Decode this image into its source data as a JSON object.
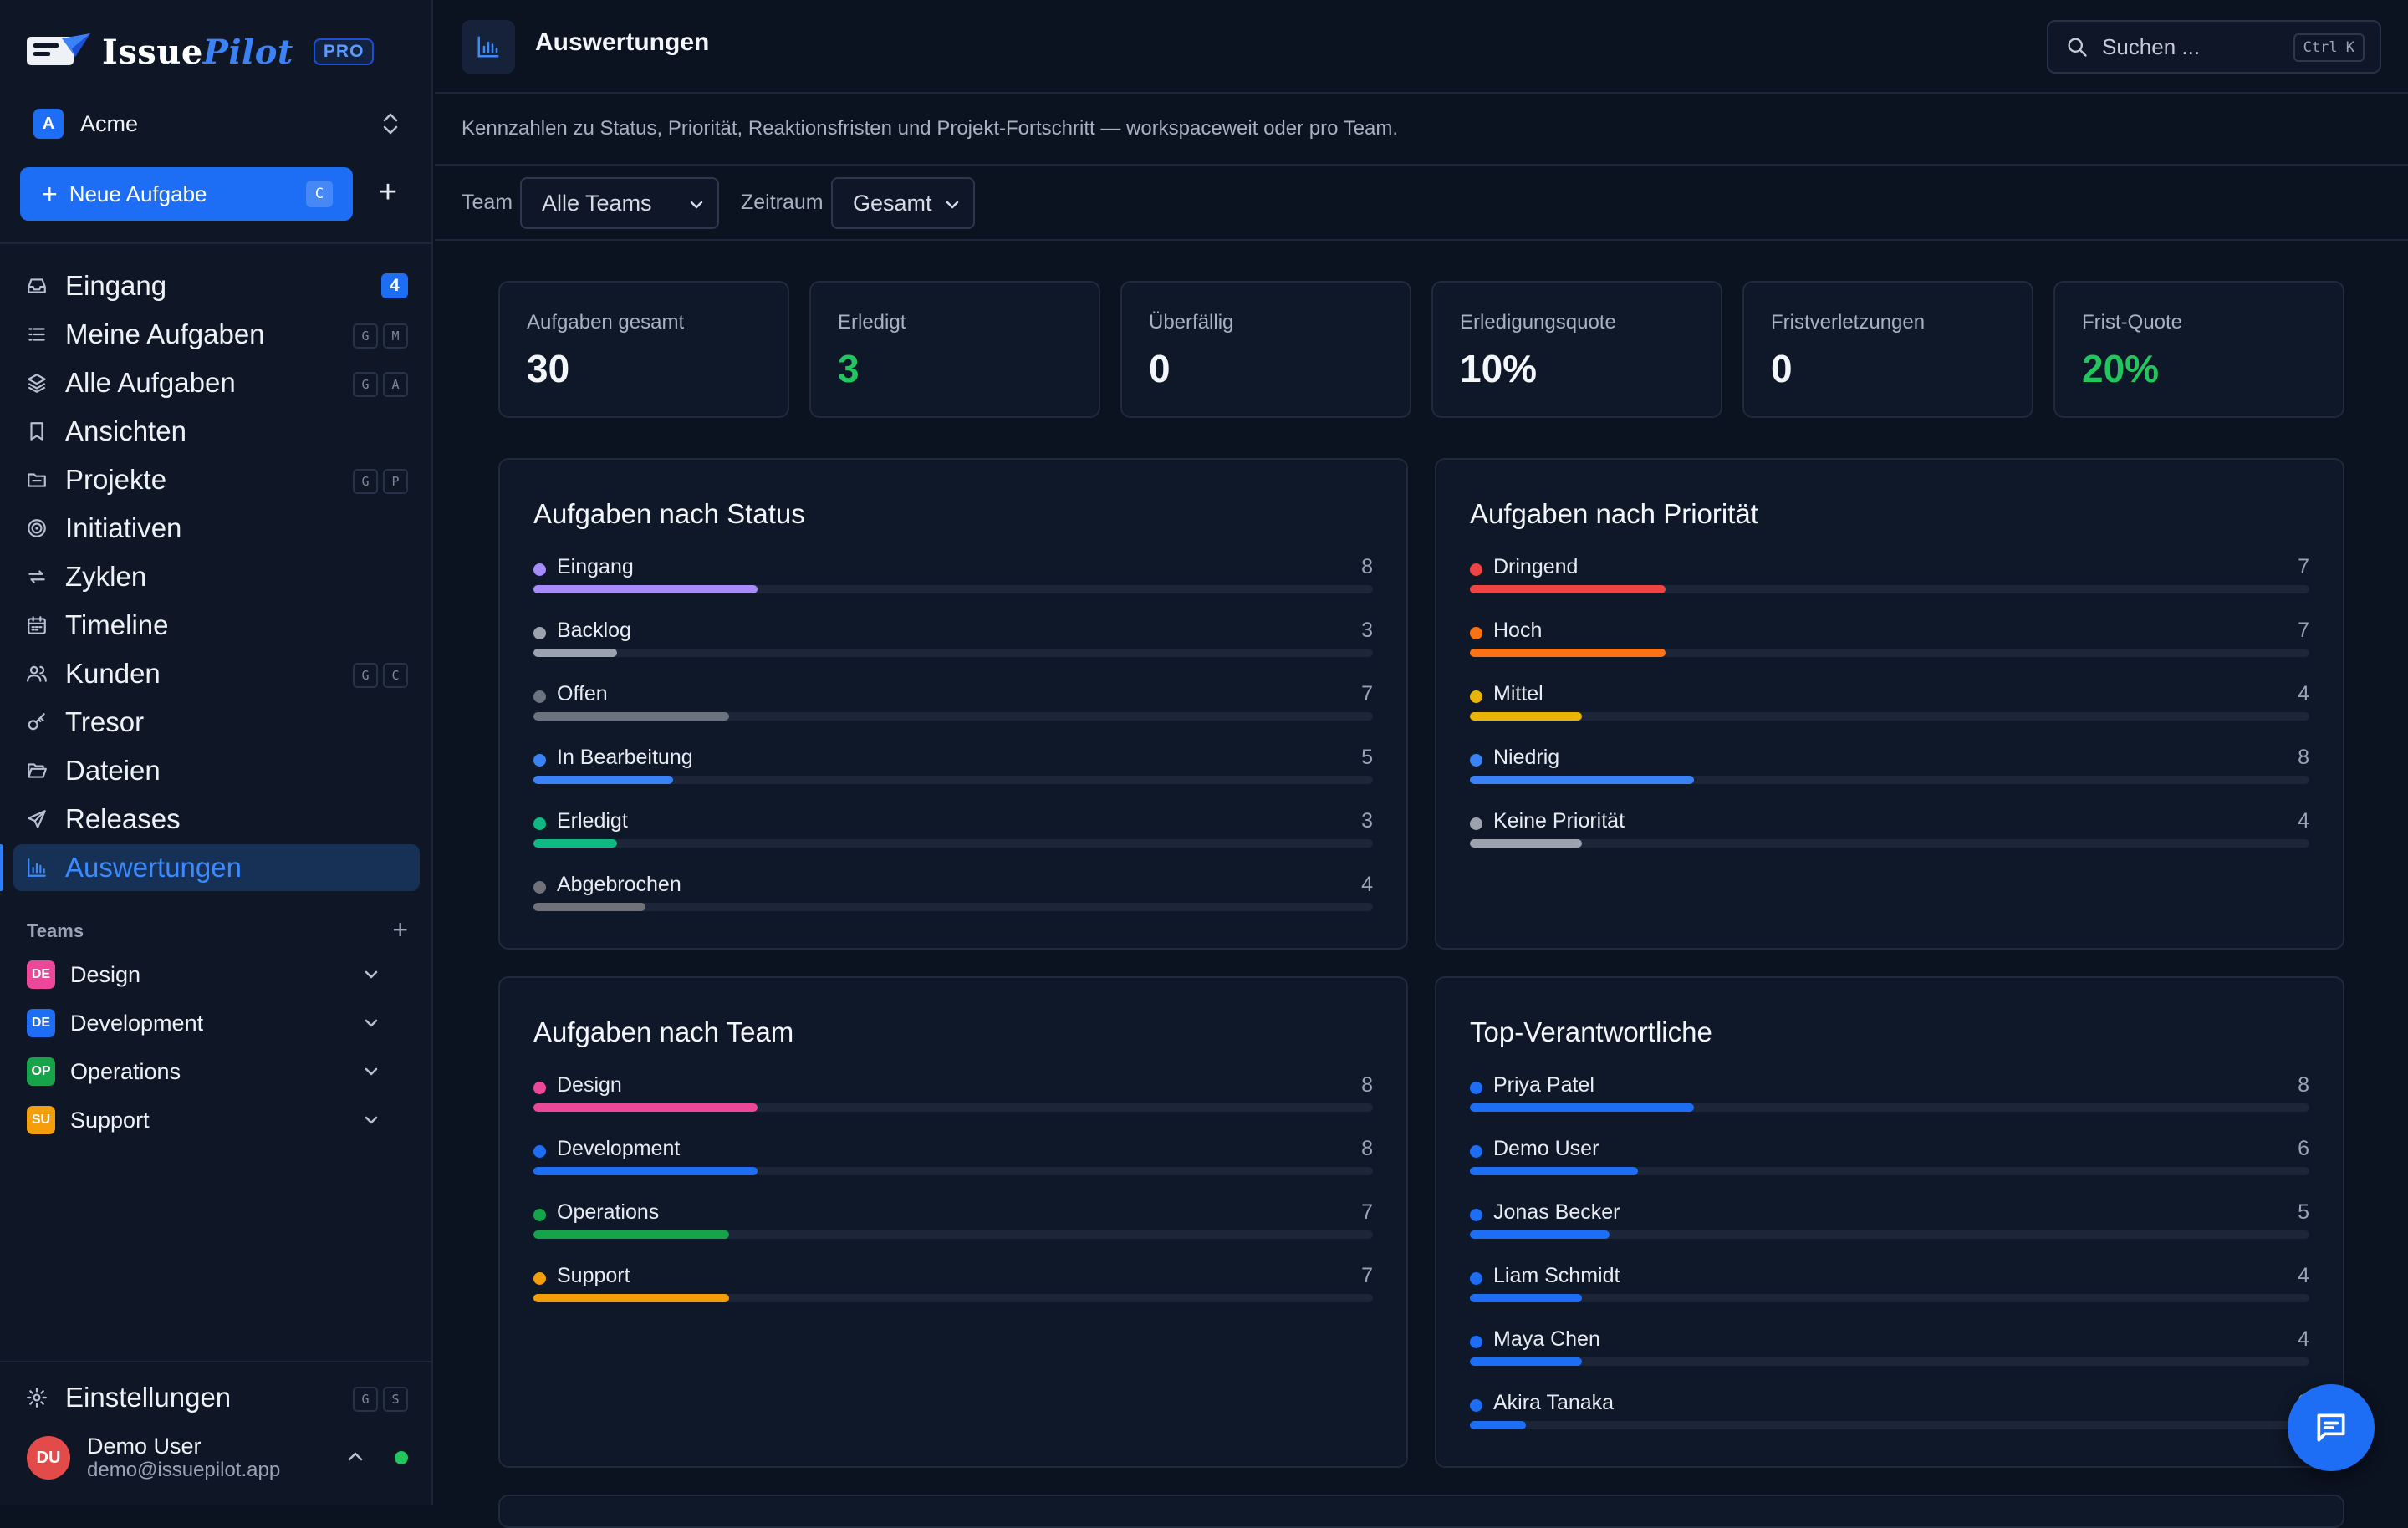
{
  "brand": {
    "name_a": "Issue",
    "name_b": "Pilot",
    "badge": "PRO"
  },
  "workspace": {
    "initial": "A",
    "name": "Acme"
  },
  "new_task": {
    "label": "Neue Aufgabe",
    "shortcut": "C"
  },
  "nav": [
    {
      "label": "Eingang",
      "icon": "inbox-icon",
      "badge": "4"
    },
    {
      "label": "Meine Aufgaben",
      "icon": "list-icon",
      "shortcut": [
        "G",
        "M"
      ]
    },
    {
      "label": "Alle Aufgaben",
      "icon": "layers-icon",
      "shortcut": [
        "G",
        "A"
      ]
    },
    {
      "label": "Ansichten",
      "icon": "bookmark-icon"
    },
    {
      "label": "Projekte",
      "icon": "folder-icon",
      "shortcut": [
        "G",
        "P"
      ]
    },
    {
      "label": "Initiativen",
      "icon": "target-icon"
    },
    {
      "label": "Zyklen",
      "icon": "cycle-icon"
    },
    {
      "label": "Timeline",
      "icon": "calendar-icon"
    },
    {
      "label": "Kunden",
      "icon": "users-icon",
      "shortcut": [
        "G",
        "C"
      ]
    },
    {
      "label": "Tresor",
      "icon": "key-icon"
    },
    {
      "label": "Dateien",
      "icon": "folder-open-icon"
    },
    {
      "label": "Releases",
      "icon": "send-icon"
    },
    {
      "label": "Auswertungen",
      "icon": "bar-chart-icon",
      "active": true
    }
  ],
  "teams": {
    "title": "Teams",
    "items": [
      {
        "initials": "DE",
        "name": "Design",
        "color": "#ec4899"
      },
      {
        "initials": "DE",
        "name": "Development",
        "color": "#1d6ef5"
      },
      {
        "initials": "OP",
        "name": "Operations",
        "color": "#16a34a"
      },
      {
        "initials": "SU",
        "name": "Support",
        "color": "#f59e0b"
      }
    ]
  },
  "settings": {
    "label": "Einstellungen",
    "shortcut": [
      "G",
      "S"
    ]
  },
  "user": {
    "initials": "DU",
    "name": "Demo User",
    "email": "demo@issuepilot.app"
  },
  "header": {
    "title": "Auswertungen",
    "search_placeholder": "Suchen ...",
    "search_shortcut": "Ctrl K",
    "subtitle": "Kennzahlen zu Status, Priorität, Reaktionsfristen und Projekt-Fortschritt — workspaceweit oder pro Team."
  },
  "filters": {
    "team_label": "Team",
    "team_value": "Alle Teams",
    "period_label": "Zeitraum",
    "period_value": "Gesamt"
  },
  "kpis": [
    {
      "label": "Aufgaben gesamt",
      "value": "30"
    },
    {
      "label": "Erledigt",
      "value": "3",
      "accent": "#22c55e"
    },
    {
      "label": "Überfällig",
      "value": "0"
    },
    {
      "label": "Erledigungsquote",
      "value": "10%"
    },
    {
      "label": "Fristverletzungen",
      "value": "0"
    },
    {
      "label": "Frist-Quote",
      "value": "20%",
      "accent": "#22c55e"
    }
  ],
  "panels": {
    "status": {
      "title": "Aufgaben nach Status",
      "max": 30,
      "rows": [
        {
          "label": "Eingang",
          "value": 8,
          "color": "#a78bfa"
        },
        {
          "label": "Backlog",
          "value": 3,
          "color": "#9ca3af"
        },
        {
          "label": "Offen",
          "value": 7,
          "color": "#6b7280"
        },
        {
          "label": "In Bearbeitung",
          "value": 5,
          "color": "#3b82f6"
        },
        {
          "label": "Erledigt",
          "value": 3,
          "color": "#10b981"
        },
        {
          "label": "Abgebrochen",
          "value": 4,
          "color": "#71717a"
        }
      ]
    },
    "priority": {
      "title": "Aufgaben nach Priorität",
      "max": 30,
      "rows": [
        {
          "label": "Dringend",
          "value": 7,
          "color": "#ef4444"
        },
        {
          "label": "Hoch",
          "value": 7,
          "color": "#f97316"
        },
        {
          "label": "Mittel",
          "value": 4,
          "color": "#eab308"
        },
        {
          "label": "Niedrig",
          "value": 8,
          "color": "#3b82f6"
        },
        {
          "label": "Keine Priorität",
          "value": 4,
          "color": "#9ca3af"
        }
      ]
    },
    "team": {
      "title": "Aufgaben nach Team",
      "max": 30,
      "rows": [
        {
          "label": "Design",
          "value": 8,
          "color": "#ec4899"
        },
        {
          "label": "Development",
          "value": 8,
          "color": "#1d6ef5"
        },
        {
          "label": "Operations",
          "value": 7,
          "color": "#16a34a"
        },
        {
          "label": "Support",
          "value": 7,
          "color": "#f59e0b"
        }
      ]
    },
    "assignees": {
      "title": "Top-Verantwortliche",
      "max": 30,
      "rows": [
        {
          "label": "Priya Patel",
          "value": 8,
          "color": "#1d6ef5"
        },
        {
          "label": "Demo User",
          "value": 6,
          "color": "#1d6ef5"
        },
        {
          "label": "Jonas Becker",
          "value": 5,
          "color": "#1d6ef5"
        },
        {
          "label": "Liam Schmidt",
          "value": 4,
          "color": "#1d6ef5"
        },
        {
          "label": "Maya Chen",
          "value": 4,
          "color": "#1d6ef5"
        },
        {
          "label": "Akira Tanaka",
          "value": 2,
          "color": "#1d6ef5"
        }
      ]
    }
  }
}
